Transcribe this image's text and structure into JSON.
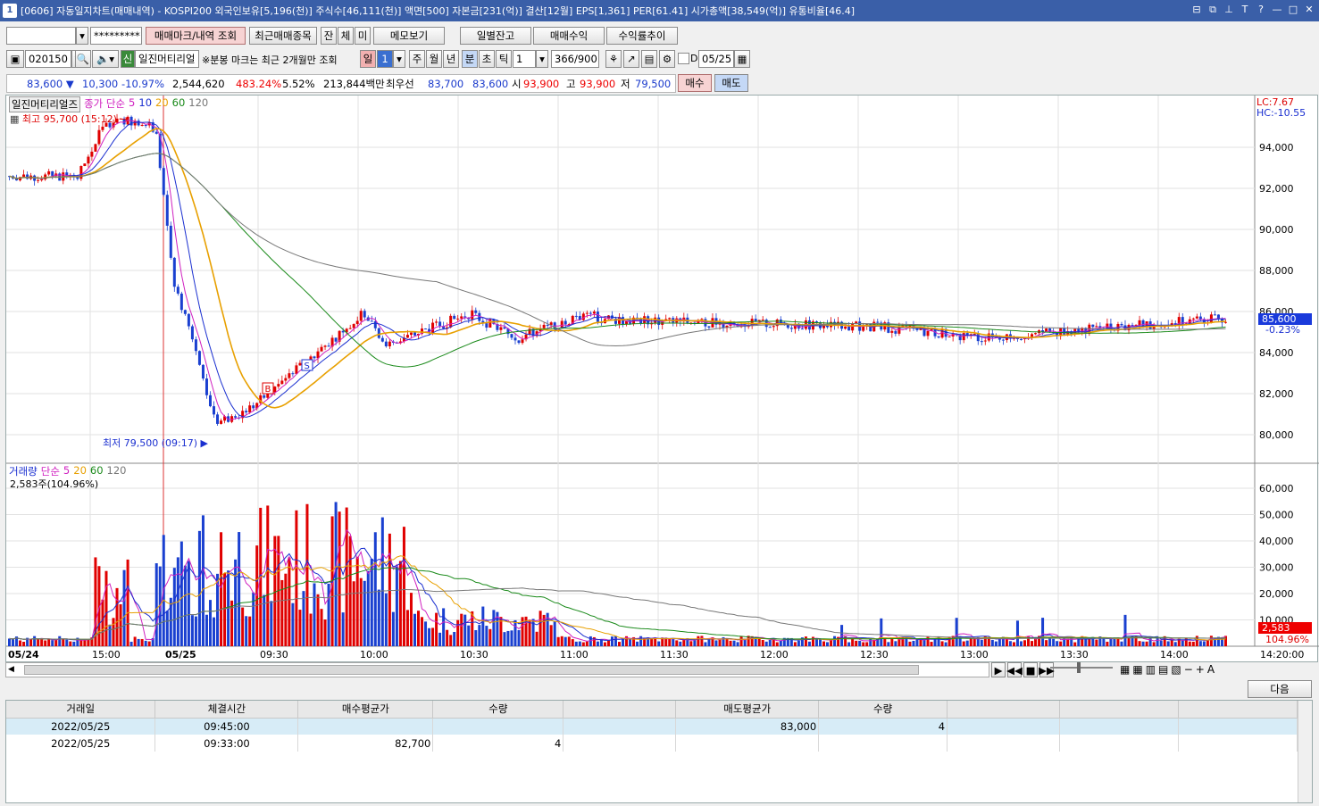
{
  "title": {
    "number": "1",
    "text": "[0606] 자동일지차트(매매내역) - KOSPI200 외국인보유[5,196(천)] 주식수[46,111(천)] 액면[500] 자본금[231(억)] 결산[12월] EPS[1,361] PER[61.41] 시가총액[38,549(억)] 유통비율[46.4]"
  },
  "toolbar1": {
    "account_placeholder": "",
    "password": "*********",
    "tab_mark": "매매마크/내역 조회",
    "tab_recent": "최근매매종목",
    "btn_jan": "잔",
    "btn_che": "체",
    "btn_mi": "미",
    "btn_memo": "메모보기",
    "btn_daily": "일별잔고",
    "btn_profit": "매매수익",
    "btn_return": "수익률추이"
  },
  "toolbar2": {
    "code": "020150",
    "shin": "신",
    "name": "일진머티리얼",
    "note": "※분봉 마크는 최근 2개월만 조회",
    "period_il": "일",
    "period_num": "1",
    "period_ju": "주",
    "period_wol": "월",
    "period_nyeon": "년",
    "period_bun": "분",
    "period_cho": "초",
    "period_tik": "틱",
    "tick_num": "1",
    "count": "366/900",
    "date_flag": "D",
    "date": "05/25"
  },
  "quote": {
    "price": "83,600",
    "arrow": "▼",
    "change": "10,300",
    "change_pct": "-10.97%",
    "volume": "2,544,620",
    "vol_ratio": "483.24%",
    "rate": "5.52%",
    "amount": "213,844백만",
    "best_label": "최우선",
    "ask": "83,700",
    "bid": "83,600",
    "open_label": "시",
    "open": "93,900",
    "high_label": "고",
    "high": "93,900",
    "low_label": "저",
    "low": "79,500",
    "buy": "매수",
    "sell": "매도"
  },
  "chart": {
    "price_legend_name": "일진머티리얼즈",
    "price_legend_ma": "종가 단순",
    "ma_periods": [
      "5",
      "10",
      "20",
      "60",
      "120"
    ],
    "high_marker": "최고 95,700 (15:12)",
    "low_marker": "최저 79,500 (09:17)",
    "lc": "LC:7.67",
    "hc": "HC:-10.55",
    "cur_price": "85,600",
    "cur_pct": "-0.23%",
    "vol_legend_name": "거래량",
    "vol_legend_ma": "단순",
    "vol_info": "2,583주(104.96%)",
    "cur_vol": "2,583",
    "cur_vol_pct": "104.96%",
    "price_ticks": [
      "94,000",
      "92,000",
      "90,000",
      "88,000",
      "86,000",
      "84,000",
      "82,000",
      "80,000"
    ],
    "vol_ticks": [
      "60,000",
      "50,000",
      "40,000",
      "30,000",
      "20,000",
      "10,000"
    ],
    "time_ticks": [
      "05/24",
      "15:00",
      "05/25",
      "09:30",
      "10:00",
      "10:30",
      "11:00",
      "11:30",
      "12:00",
      "12:30",
      "13:00",
      "13:30",
      "14:00"
    ],
    "end_time": "14:20:00",
    "colors": {
      "ma5": "#d020c0",
      "ma10": "#1a2fd0",
      "ma20": "#e8a000",
      "ma60": "#1a8a1a",
      "ma120": "#777777",
      "up": "#e00000",
      "down": "#1a40d0"
    }
  },
  "scroll": {
    "next": "다음"
  },
  "table": {
    "headers": [
      "거래일",
      "체결시간",
      "매수평균가",
      "수량",
      "",
      "매도평균가",
      "수량",
      "",
      "",
      ""
    ],
    "rows": [
      [
        "2022/05/25",
        "09:45:00",
        "",
        "",
        "",
        "83,000",
        "4",
        "",
        "",
        ""
      ],
      [
        "2022/05/25",
        "09:33:00",
        "82,700",
        "4",
        "",
        "",
        "",
        "",
        "",
        ""
      ]
    ]
  }
}
